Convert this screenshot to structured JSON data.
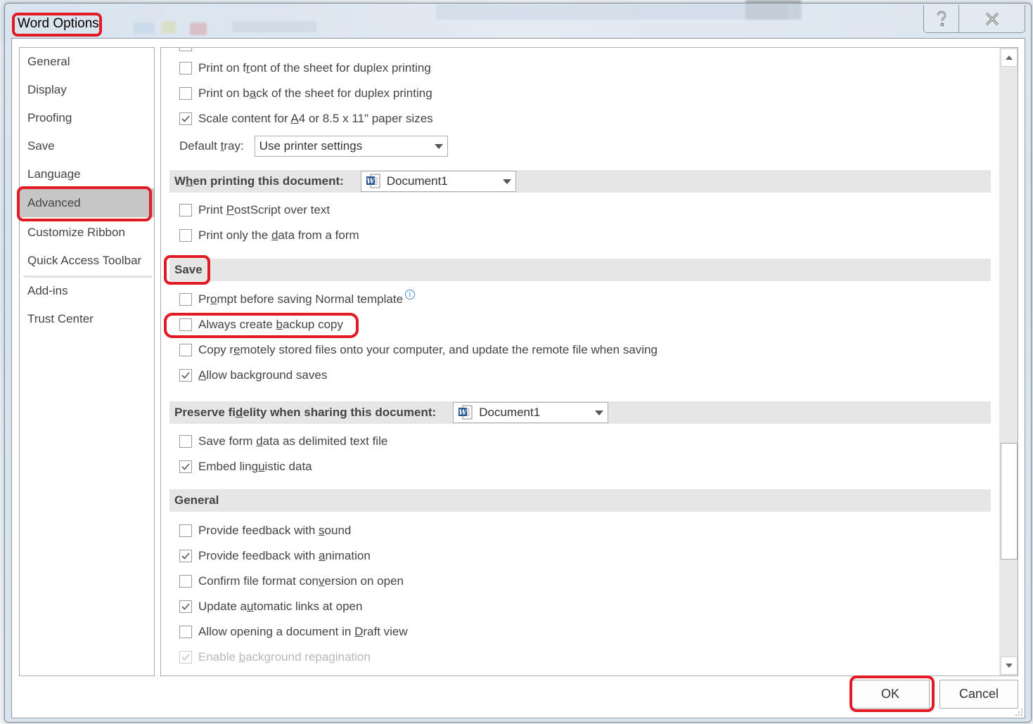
{
  "window": {
    "title": "Word Options",
    "help_button_label": "?",
    "close_button_label": "X"
  },
  "sidebar": {
    "items": [
      {
        "label": "General",
        "selected": false
      },
      {
        "label": "Display",
        "selected": false
      },
      {
        "label": "Proofing",
        "selected": false
      },
      {
        "label": "Save",
        "selected": false
      },
      {
        "label": "Language",
        "selected": false
      },
      {
        "label": "Advanced",
        "selected": true
      },
      {
        "label": "Customize Ribbon",
        "selected": false
      },
      {
        "label": "Quick Access Toolbar",
        "selected": false
      },
      {
        "label": "Add-ins",
        "selected": false
      },
      {
        "label": "Trust Center",
        "selected": false
      }
    ]
  },
  "print": {
    "options": [
      {
        "label_pre": "Print on f",
        "accel": "r",
        "label_post": "ont of the sheet for duplex printing",
        "checked": false
      },
      {
        "label_pre": "Print on b",
        "accel": "a",
        "label_post": "ck of the sheet for duplex printing",
        "checked": false
      },
      {
        "label_pre": "Scale content for ",
        "accel": "A",
        "label_post": "4 or 8.5 x 11\" paper sizes",
        "checked": true
      }
    ],
    "default_tray": {
      "label_pre": "Default ",
      "accel": "t",
      "label_post": "ray:",
      "value": "Use printer settings"
    }
  },
  "when_printing": {
    "header_pre": "W",
    "header_accel": "h",
    "header_post": "en printing this document:",
    "document": "Document1",
    "options": [
      {
        "label_pre": "Print ",
        "accel": "P",
        "label_post": "ostScript over text",
        "checked": false
      },
      {
        "label_pre": "Print only the ",
        "accel": "d",
        "label_post": "ata from a form",
        "checked": false
      }
    ]
  },
  "save": {
    "header": "Save",
    "options": [
      {
        "label_pre": "Pr",
        "accel": "o",
        "label_post": "mpt before saving Normal template",
        "checked": false,
        "info": true
      },
      {
        "label_pre": "Always create ",
        "accel": "b",
        "label_post": "ackup copy",
        "checked": false
      },
      {
        "label_pre": "Copy r",
        "accel": "e",
        "label_post": "motely stored files onto your computer, and update the remote file when saving",
        "checked": false
      },
      {
        "label_pre": "",
        "accel": "A",
        "label_post": "llow background saves",
        "checked": true
      }
    ],
    "info_icon_glyph": "i"
  },
  "preserve_fidelity": {
    "header_pre": "Preserve fi",
    "header_accel": "d",
    "header_post": "elity when sharing this document:",
    "document": "Document1",
    "options": [
      {
        "label_pre": "Save form ",
        "accel": "d",
        "label_post": "ata as delimited text file",
        "checked": false
      },
      {
        "label_pre": "Embed ling",
        "accel": "u",
        "label_post": "istic data",
        "checked": true
      }
    ]
  },
  "general": {
    "header": "General",
    "options": [
      {
        "label_pre": "Provide feedback with ",
        "accel": "s",
        "label_post": "ound",
        "checked": false,
        "disabled": false
      },
      {
        "label_pre": "Provide feedback with ",
        "accel": "a",
        "label_post": "nimation",
        "checked": true,
        "disabled": false
      },
      {
        "label_pre": "Confirm file format con",
        "accel": "v",
        "label_post": "ersion on open",
        "checked": false,
        "disabled": false
      },
      {
        "label_pre": "Update a",
        "accel": "u",
        "label_post": "tomatic links at open",
        "checked": true,
        "disabled": false
      },
      {
        "label_pre": "Allow opening a document in ",
        "accel": "D",
        "label_post": "raft view",
        "checked": false,
        "disabled": false
      },
      {
        "label_pre": "Enable ",
        "accel": "b",
        "label_post": "ackground repagination",
        "checked": true,
        "disabled": true
      }
    ]
  },
  "footer": {
    "ok_label": "OK",
    "cancel_label": "Cancel"
  },
  "colors": {
    "annotation_red": "#e01b24",
    "selected_nav_bg": "#c6c6c6",
    "section_header_bg": "#e6e6e6",
    "word_icon_blue": "#2b579a"
  }
}
